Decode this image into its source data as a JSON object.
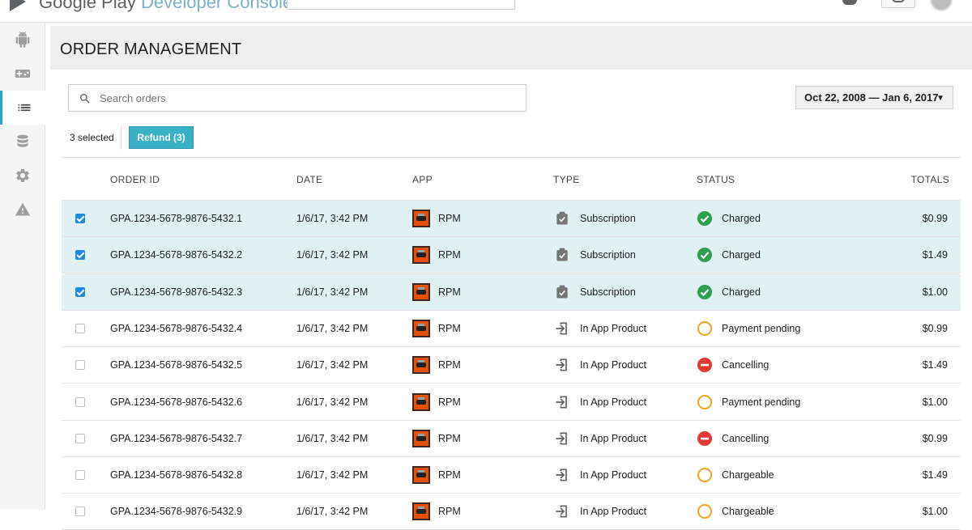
{
  "app": {
    "brand_part1": "Google Play",
    "brand_part2": "Developer Console"
  },
  "sidebar": {
    "items": [
      {
        "icon": "android-icon"
      },
      {
        "icon": "gamepad-icon"
      },
      {
        "icon": "orders-list-icon",
        "active": true
      },
      {
        "icon": "database-icon"
      },
      {
        "icon": "settings-gear-icon"
      },
      {
        "icon": "warning-icon"
      }
    ]
  },
  "page": {
    "title": "ORDER MANAGEMENT"
  },
  "search": {
    "placeholder": "Search orders",
    "value": ""
  },
  "date_range": {
    "label": "Oct 22, 2008 — Jan 6, 2017"
  },
  "selection": {
    "count_label": "3 selected",
    "refund_label": "Refund (3)"
  },
  "table": {
    "headers": {
      "order_id": "ORDER ID",
      "date": "DATE",
      "app": "APP",
      "type": "TYPE",
      "status": "STATUS",
      "totals": "TOTALS"
    },
    "rows": [
      {
        "selected": true,
        "order_id": "GPA.1234-5678-9876-5432.1",
        "date": "1/6/17, 3:42 PM",
        "app": "RPM",
        "type": "Subscription",
        "type_icon": "subscription-icon",
        "status": "Charged",
        "status_icon": "check-circle-icon",
        "total": "$0.99"
      },
      {
        "selected": true,
        "order_id": "GPA.1234-5678-9876-5432.2",
        "date": "1/6/17, 3:42 PM",
        "app": "RPM",
        "type": "Subscription",
        "type_icon": "subscription-icon",
        "status": "Charged",
        "status_icon": "check-circle-icon",
        "total": "$1.49"
      },
      {
        "selected": true,
        "order_id": "GPA.1234-5678-9876-5432.3",
        "date": "1/6/17, 3:42 PM",
        "app": "RPM",
        "type": "Subscription",
        "type_icon": "subscription-icon",
        "status": "Charged",
        "status_icon": "check-circle-icon",
        "total": "$1.00"
      },
      {
        "selected": false,
        "order_id": "GPA.1234-5678-9876-5432.4",
        "date": "1/6/17, 3:42 PM",
        "app": "RPM",
        "type": "In App Product",
        "type_icon": "in-app-product-icon",
        "status": "Payment pending",
        "status_icon": "pending-circle-icon",
        "total": "$0.99"
      },
      {
        "selected": false,
        "order_id": "GPA.1234-5678-9876-5432.5",
        "date": "1/6/17, 3:42 PM",
        "app": "RPM",
        "type": "In App Product",
        "type_icon": "in-app-product-icon",
        "status": "Cancelling",
        "status_icon": "cancel-circle-icon",
        "total": "$1.49"
      },
      {
        "selected": false,
        "order_id": "GPA.1234-5678-9876-5432.6",
        "date": "1/6/17, 3:42 PM",
        "app": "RPM",
        "type": "In App Product",
        "type_icon": "in-app-product-icon",
        "status": "Payment pending",
        "status_icon": "pending-circle-icon",
        "total": "$1.00"
      },
      {
        "selected": false,
        "order_id": "GPA.1234-5678-9876-5432.7",
        "date": "1/6/17, 3:42 PM",
        "app": "RPM",
        "type": "In App Product",
        "type_icon": "in-app-product-icon",
        "status": "Cancelling",
        "status_icon": "cancel-circle-icon",
        "total": "$0.99"
      },
      {
        "selected": false,
        "order_id": "GPA.1234-5678-9876-5432.8",
        "date": "1/6/17, 3:42 PM",
        "app": "RPM",
        "type": "In App Product",
        "type_icon": "in-app-product-icon",
        "status": "Chargeable",
        "status_icon": "pending-circle-icon",
        "total": "$1.49"
      },
      {
        "selected": false,
        "order_id": "GPA.1234-5678-9876-5432.9",
        "date": "1/6/17, 3:42 PM",
        "app": "RPM",
        "type": "In App Product",
        "type_icon": "in-app-product-icon",
        "status": "Chargeable",
        "status_icon": "pending-circle-icon",
        "total": "$1.00"
      }
    ]
  },
  "colors": {
    "accent": "#3ab0c7",
    "selected_row": "#e1f1f3",
    "charged": "#2e9e4f",
    "pending": "#f4a31a",
    "cancelling": "#e53935"
  }
}
